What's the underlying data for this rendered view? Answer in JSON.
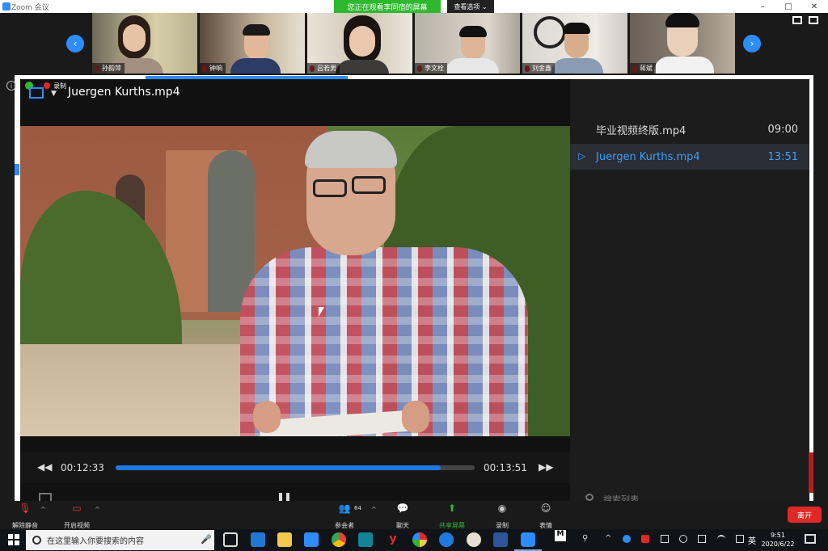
{
  "window": {
    "app_title": "Zoom 会议",
    "share_banner": "您正在观看李同宿的屏幕",
    "view_options": "查看选项",
    "min": "–",
    "max": "□",
    "close": "✕"
  },
  "participants": [
    {
      "name": "孙韵萍"
    },
    {
      "name": "钟响"
    },
    {
      "name": "吕若男"
    },
    {
      "name": "李文栓"
    },
    {
      "name": "刘金鑫"
    },
    {
      "name": "蒋斌"
    }
  ],
  "gallery": {
    "prev": "‹",
    "next": "›"
  },
  "recording": {
    "label": "录制"
  },
  "player": {
    "title": "Juergen Kurths.mp4",
    "current_time": "00:12:33",
    "total_time": "00:13:51",
    "progress": 0.906,
    "rewind": "◀◀",
    "forward": "▶▶"
  },
  "playlist": {
    "items": [
      {
        "name": "毕业视频终版.mp4",
        "duration": "09:00",
        "active": false
      },
      {
        "name": "Juergen Kurths.mp4",
        "duration": "13:51",
        "active": true
      }
    ],
    "play_marker": "▷",
    "search_placeholder": "搜索列表"
  },
  "toolbar": {
    "unmute": "解除静音",
    "start_video": "开启视频",
    "participants": "参会者",
    "participants_count": "64",
    "chat": "聊天",
    "share_screen": "共享屏幕",
    "record": "录制",
    "reactions": "表情",
    "leave": "离开"
  },
  "taskbar": {
    "search_placeholder": "在这里输入你要搜索的内容",
    "time": "9:51",
    "date": "2020/6/22",
    "ime": "英"
  },
  "colors": {
    "accent": "#2d8cff",
    "share_green": "#2eb82e",
    "leave_red": "#e02828",
    "playlist_active": "#3aa0ff"
  }
}
